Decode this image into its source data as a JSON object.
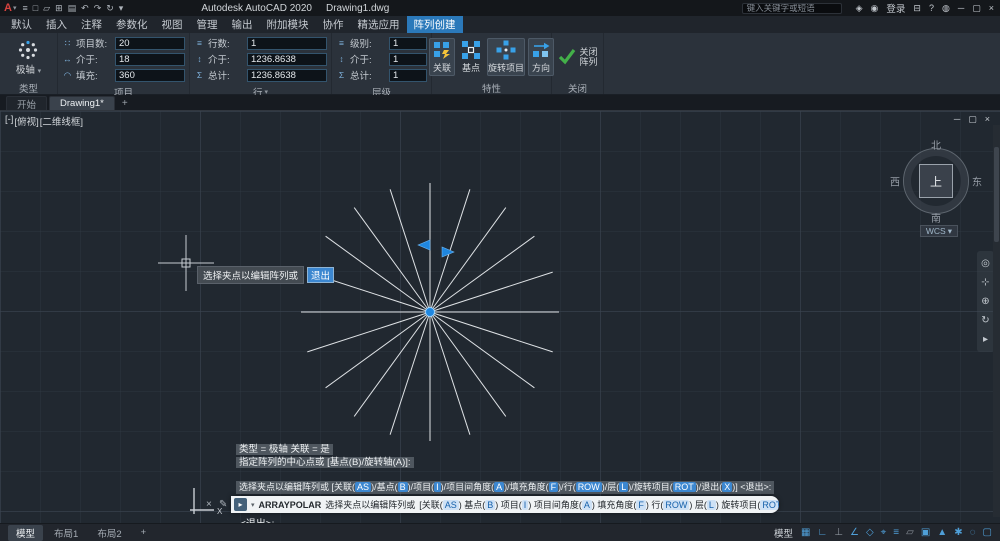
{
  "icons": {
    "caret_down": "▾",
    "close": "×",
    "minimize": "─",
    "restore": "▢",
    "edit_pencil": "✎",
    "prompt_arrow": "▸"
  },
  "title_bar": {
    "logo": "A",
    "qat_icons": [
      {
        "name": "app-menu-icon",
        "glyph": "≡"
      },
      {
        "name": "new-file-icon",
        "glyph": "□"
      },
      {
        "name": "open-file-icon",
        "glyph": "▱"
      },
      {
        "name": "save-icon",
        "glyph": "⊞"
      },
      {
        "name": "print-icon",
        "glyph": "▤"
      },
      {
        "name": "undo-icon",
        "glyph": "↶"
      },
      {
        "name": "redo-icon",
        "glyph": "↷"
      },
      {
        "name": "refresh-icon",
        "glyph": "↻"
      },
      {
        "name": "qat-dropdown-icon",
        "glyph": "▾"
      }
    ],
    "title_app": "Autodesk AutoCAD 2020",
    "title_doc": "Drawing1.dwg",
    "search_placeholder": "键入关键字或短语",
    "right": {
      "community_icon": "◈",
      "user_icon": "◉",
      "sign_in": "登录",
      "store_icon": "⊟",
      "help_icon": "?",
      "alert_icon": "◍"
    }
  },
  "ribbon": {
    "tabs": [
      "默认",
      "插入",
      "注释",
      "参数化",
      "视图",
      "管理",
      "输出",
      "附加模块",
      "协作",
      "精选应用",
      "阵列创建"
    ],
    "active_tab": "阵列创建",
    "type_panel": {
      "caption": "类型",
      "button_label": "极轴"
    },
    "items_panel": {
      "caption": "项目",
      "rows": [
        {
          "label": "项目数:",
          "value": "20",
          "icon": "∷"
        },
        {
          "label": "介于:",
          "value": "18",
          "icon": "↔"
        },
        {
          "label": "填充:",
          "value": "360",
          "icon": "◠"
        }
      ]
    },
    "rows_panel": {
      "caption": "行",
      "rows": [
        {
          "label": "行数:",
          "value": "1",
          "icon": "≡"
        },
        {
          "label": "介于:",
          "value": "1236.8638",
          "icon": "↕"
        },
        {
          "label": "总计:",
          "value": "1236.8638",
          "icon": "Σ"
        }
      ]
    },
    "levels_panel": {
      "caption": "层级",
      "rows": [
        {
          "label": "级别:",
          "value": "1",
          "icon": "≡"
        },
        {
          "label": "介于:",
          "value": "1",
          "icon": "↕"
        },
        {
          "label": "总计:",
          "value": "1",
          "icon": "Σ"
        }
      ]
    },
    "properties_panel": {
      "caption": "特性",
      "buttons": [
        {
          "label": "关联",
          "active": true
        },
        {
          "label": "基点",
          "active": false
        },
        {
          "label": "旋转项目",
          "active": true
        },
        {
          "label": "方向",
          "active": true
        }
      ]
    },
    "close_panel": {
      "caption": "关闭",
      "button_label": "关闭阵列"
    }
  },
  "file_tabs": {
    "items": [
      {
        "label": "开始",
        "active": false
      },
      {
        "label": "Drawing1*",
        "active": true
      }
    ],
    "new_tab": "+"
  },
  "canvas": {
    "viewport_controls": [
      "[-]",
      "[俯视]",
      "[二维线框]"
    ],
    "ray_count": 20,
    "ucs_axis_label": "X",
    "viewcube": {
      "north": "北",
      "south": "南",
      "east": "东",
      "west": "西",
      "top": "上",
      "wcs_label": "WCS"
    },
    "tooltip": {
      "label": "选择夹点以编辑阵列或",
      "value": "退出"
    },
    "nav_icons": [
      {
        "name": "steering-wheel-icon",
        "glyph": "◎"
      },
      {
        "name": "pan-icon",
        "glyph": "⊹"
      },
      {
        "name": "zoom-icon",
        "glyph": "⊕"
      },
      {
        "name": "orbit-icon",
        "glyph": "↻"
      },
      {
        "name": "showmotion-icon",
        "glyph": "▸"
      }
    ]
  },
  "command": {
    "history": [
      "类型 = 极轴      关联 = 是",
      "指定阵列的中心点或 [基点(B)/旋转轴(A)]:"
    ],
    "name": "ARRAYPOLAR",
    "prompt": "选择夹点以编辑阵列或",
    "options": [
      {
        "label": "关联",
        "key": "AS"
      },
      {
        "label": "基点",
        "key": "B"
      },
      {
        "label": "项目",
        "key": "I"
      },
      {
        "label": "项目间角度",
        "key": "A"
      },
      {
        "label": "填充角度",
        "key": "F"
      },
      {
        "label": "行",
        "key": "ROW"
      },
      {
        "label": "层",
        "key": "L"
      },
      {
        "label": "旋转项目",
        "key": "ROT"
      },
      {
        "label": "退出",
        "key": "X"
      }
    ],
    "default_suffix": "<退出>:",
    "continuation": "<退出>:"
  },
  "status_bar": {
    "layout_tabs": [
      {
        "label": "模型",
        "active": true
      },
      {
        "label": "布局1",
        "active": false
      },
      {
        "label": "布局2",
        "active": false
      }
    ],
    "new_layout": "+",
    "model_button": "模型",
    "icons": [
      {
        "name": "grid-icon",
        "glyph": "▦",
        "on": true
      },
      {
        "name": "snap-icon",
        "glyph": "∟",
        "on": true
      },
      {
        "name": "ortho-icon",
        "glyph": "⊥",
        "on": false
      },
      {
        "name": "polar-tracking-icon",
        "glyph": "∠",
        "on": true
      },
      {
        "name": "isodraft-icon",
        "glyph": "◇",
        "on": true
      },
      {
        "name": "object-snap-icon",
        "glyph": "⌖",
        "on": true
      },
      {
        "name": "lineweight-icon",
        "glyph": "≡",
        "on": true
      },
      {
        "name": "transparency-icon",
        "glyph": "▱",
        "on": false
      },
      {
        "name": "selection-cycling-icon",
        "glyph": "▣",
        "on": true
      },
      {
        "name": "annotation-scale-icon",
        "glyph": "▲",
        "on": true
      },
      {
        "name": "workspace-gear-icon",
        "glyph": "✱",
        "on": true
      },
      {
        "name": "isolate-objects-icon",
        "glyph": "◌",
        "on": true
      },
      {
        "name": "clean-screen-icon",
        "glyph": "▢",
        "on": true
      }
    ]
  }
}
